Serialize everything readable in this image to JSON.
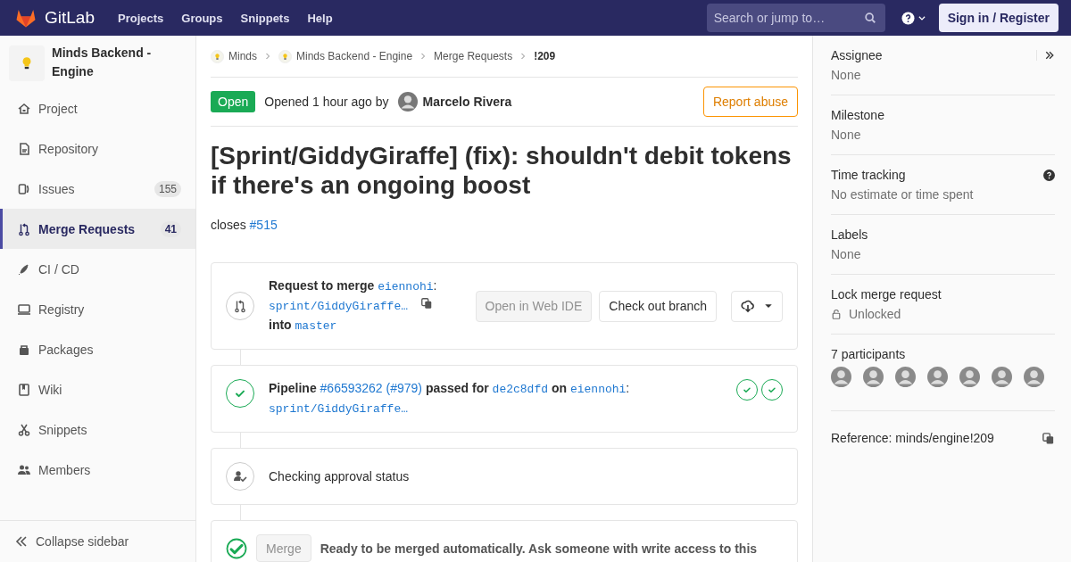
{
  "header": {
    "logo": "GitLab",
    "nav": [
      "Projects",
      "Groups",
      "Snippets",
      "Help"
    ],
    "search": {
      "placeholder": "Search or jump to…"
    },
    "sign_in": "Sign in / Register"
  },
  "sidebar": {
    "project": "Minds Backend - Engine",
    "items": [
      {
        "label": "Project",
        "selected": false
      },
      {
        "label": "Repository",
        "selected": false
      },
      {
        "label": "Issues",
        "count": "155",
        "selected": false
      },
      {
        "label": "Merge Requests",
        "count": "41",
        "selected": true
      },
      {
        "label": "CI / CD",
        "selected": false
      },
      {
        "label": "Registry",
        "selected": false
      },
      {
        "label": "Packages",
        "selected": false
      },
      {
        "label": "Wiki",
        "selected": false
      },
      {
        "label": "Snippets",
        "selected": false
      },
      {
        "label": "Members",
        "selected": false
      }
    ],
    "collapse": "Collapse sidebar"
  },
  "breadcrumbs": [
    {
      "label": "Minds",
      "kind": "avatar"
    },
    {
      "label": "Minds Backend - Engine",
      "kind": "avatar"
    },
    {
      "label": "Merge Requests",
      "kind": "plain"
    },
    {
      "label": "!209",
      "kind": "current"
    }
  ],
  "merge_request": {
    "status": "Open",
    "opened": "Opened 1 hour ago by",
    "author": "Marcelo Rivera",
    "report": "Report abuse",
    "title": "[Sprint/GiddyGiraffe] (fix): shouldn't debit tokens if there's an ongoing boost",
    "description": {
      "text": "closes",
      "link": "#515"
    }
  },
  "widgets": [
    {
      "kind": "request",
      "lead": "Request to merge",
      "source_project": "eiennohi",
      "separator": ":",
      "source_branch": "sprint/GiddyGiraffe…",
      "into": "into",
      "target_branch": "master",
      "buttons": [
        {
          "label": "Open in Web IDE",
          "disabled": true
        },
        {
          "label": "Check out branch",
          "disabled": false
        }
      ]
    },
    {
      "kind": "pipeline",
      "lead": "Pipeline",
      "pipeline": "#66593262 (#979)",
      "passed": "passed for",
      "commit": "de2c8dfd",
      "on": "on",
      "project": "eiennohi",
      "separator": ":",
      "branch": "sprint/GiddyGiraffe…",
      "stages": [
        {
          "passed": true
        },
        {
          "passed": true
        }
      ]
    },
    {
      "kind": "approval",
      "text": "Checking approval status"
    },
    {
      "kind": "merge",
      "button": {
        "label": "Merge",
        "disabled": true
      },
      "text": "Ready to be merged automatically. Ask someone with write access to this"
    }
  ],
  "right_sidebar": [
    {
      "kind": "field",
      "title": "Assignee",
      "value": "None"
    },
    {
      "kind": "field",
      "title": "Milestone",
      "value": "None"
    },
    {
      "kind": "help",
      "title": "Time tracking",
      "value": "No estimate or time spent"
    },
    {
      "kind": "field",
      "title": "Labels",
      "value": "None"
    },
    {
      "kind": "lock",
      "title": "Lock merge request",
      "value": "Unlocked"
    },
    {
      "kind": "participants",
      "title": "7 participants"
    },
    {
      "kind": "reference",
      "title": "Reference: minds/engine!209"
    }
  ]
}
